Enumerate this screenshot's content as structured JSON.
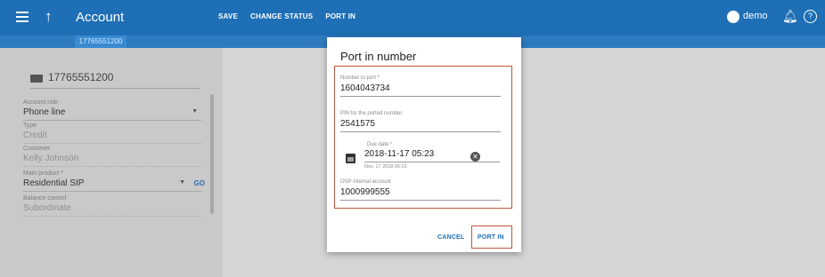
{
  "appbar": {
    "title": "Account",
    "actions": [
      "SAVE",
      "CHANGE STATUS",
      "PORT IN"
    ],
    "user": "demo",
    "sub_tab": "17765551200"
  },
  "panel": {
    "account_id": "17765551200",
    "fields": [
      {
        "label": "Account role",
        "value": "Phone line"
      },
      {
        "label": "Type",
        "value": "Credit"
      },
      {
        "label": "Customer",
        "value": "Kelly Johnson"
      },
      {
        "label": "Main product *",
        "value": "Residential SIP",
        "go": "GO"
      },
      {
        "label": "Balance control",
        "value": "Subordinate"
      }
    ]
  },
  "dialog": {
    "title": "Port in number",
    "number_to_port": {
      "label": "Number to port *",
      "value": "1604043734"
    },
    "pin": {
      "label": "PIN for the ported number",
      "value": "2541575"
    },
    "due_date": {
      "label": "Due date *",
      "value": "2018-11-17 05:23",
      "hint": "Nov. 17 2018 05:23"
    },
    "osp_account": {
      "label": "OSP internal account",
      "value": "1000999555"
    },
    "cancel_label": "CANCEL",
    "port_in_label": "PORT IN"
  }
}
